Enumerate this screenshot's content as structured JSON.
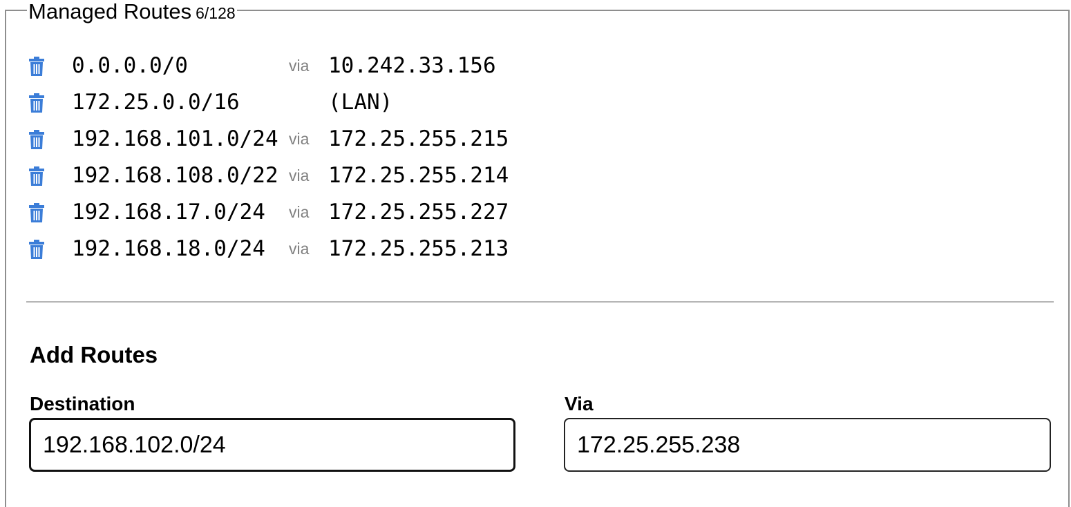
{
  "managed_routes": {
    "title": "Managed Routes",
    "count": "6/128",
    "via_label": "via",
    "icon": "trash-icon",
    "icon_color": "#3b7dd8",
    "rows": [
      {
        "destination": "0.0.0.0/0",
        "via": "via",
        "gateway": "10.242.33.156"
      },
      {
        "destination": "172.25.0.0/16",
        "via": "",
        "gateway": "(LAN)"
      },
      {
        "destination": "192.168.101.0/24",
        "via": "via",
        "gateway": "172.25.255.215"
      },
      {
        "destination": "192.168.108.0/22",
        "via": "via",
        "gateway": "172.25.255.214"
      },
      {
        "destination": "192.168.17.0/24",
        "via": "via",
        "gateway": "172.25.255.227"
      },
      {
        "destination": "192.168.18.0/24",
        "via": "via",
        "gateway": "172.25.255.213"
      }
    ]
  },
  "add_routes": {
    "title": "Add Routes",
    "destination": {
      "label": "Destination",
      "value": "192.168.102.0/24"
    },
    "via": {
      "label": "Via",
      "value": "172.25.255.238"
    }
  }
}
